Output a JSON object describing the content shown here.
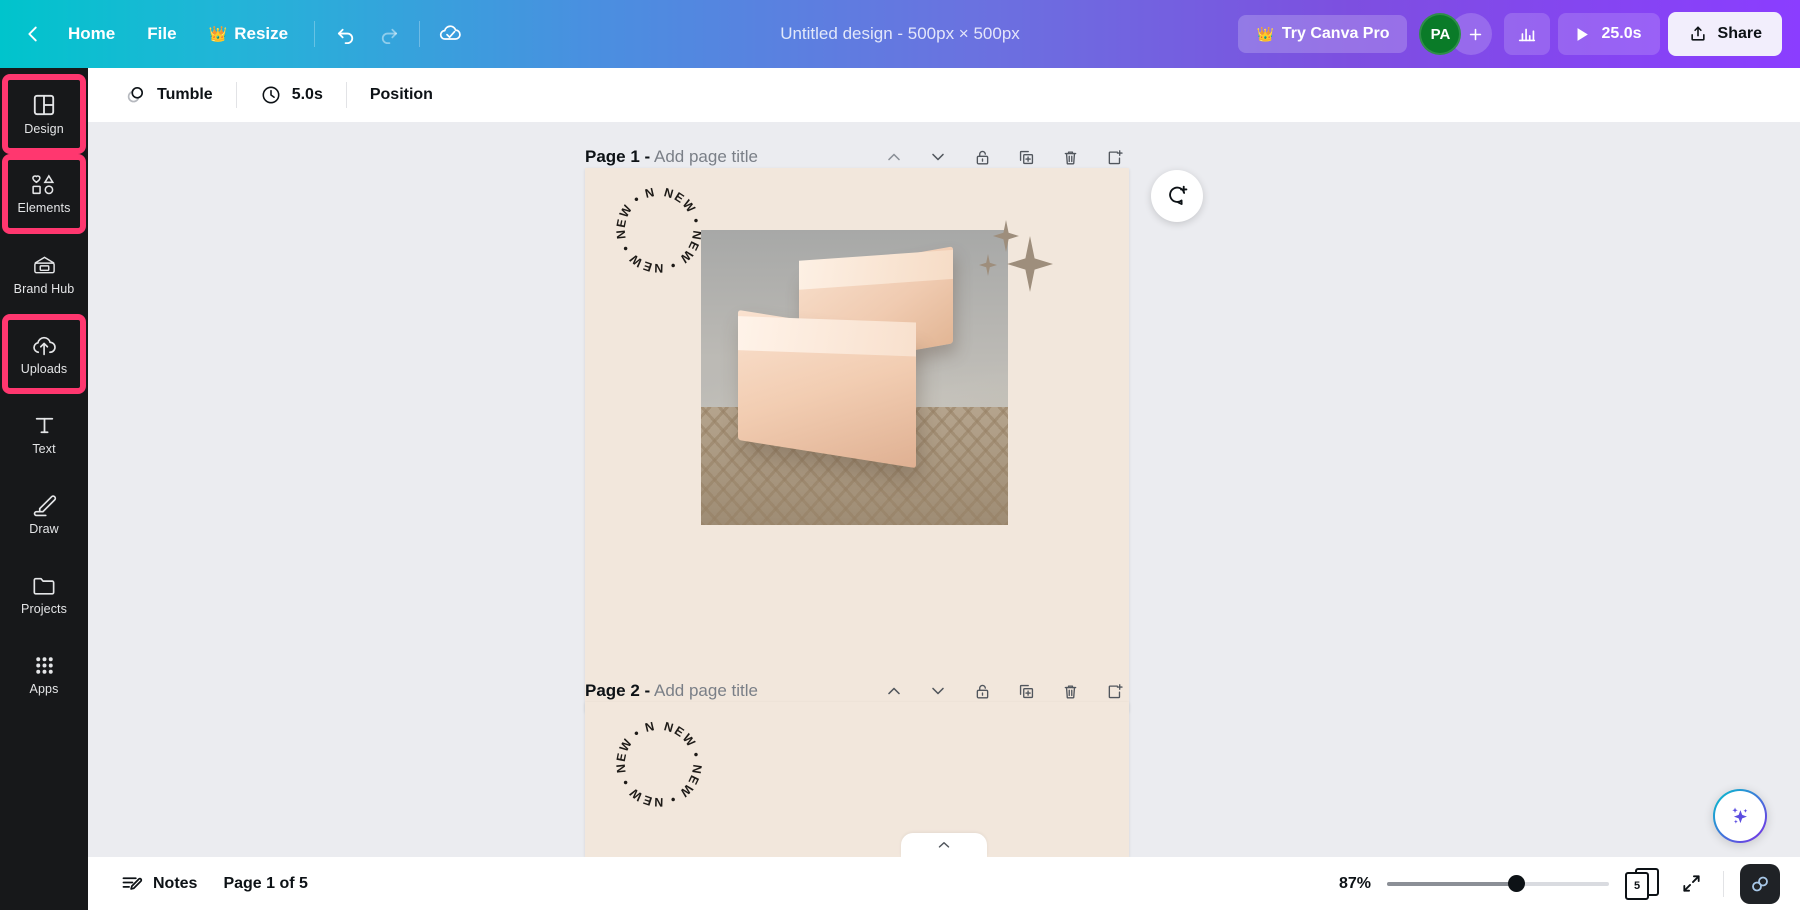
{
  "topbar": {
    "back_icon": "chevron-left-icon",
    "home_label": "Home",
    "file_label": "File",
    "resize_label": "Resize",
    "resize_icon": "crown-icon",
    "undo_icon": "undo-icon",
    "redo_icon": "redo-icon",
    "saved_icon": "cloud-check-icon",
    "design_title": "Untitled design - 500px × 500px",
    "pro_label": "Try Canva Pro",
    "pro_icon": "crown-icon",
    "avatar_initials": "PA",
    "avatar_color": "#0a7b28",
    "add_collaborator_icon": "plus-icon",
    "insights_icon": "bar-chart-icon",
    "play_icon": "play-icon",
    "duration_label": "25.0s",
    "share_label": "Share",
    "share_icon": "upload-icon",
    "gradient_start": "#00c4cc",
    "gradient_end": "#8b3dff"
  },
  "sidebar": {
    "highlight_color": "#ff376f",
    "items": [
      {
        "label": "Design",
        "icon": "layout-grid-icon",
        "highlighted": true
      },
      {
        "label": "Elements",
        "icon": "shapes-icon",
        "highlighted": true
      },
      {
        "label": "Brand Hub",
        "icon": "brand-wallet-icon",
        "highlighted": false
      },
      {
        "label": "Uploads",
        "icon": "cloud-upload-icon",
        "highlighted": true
      },
      {
        "label": "Text",
        "icon": "text-t-icon",
        "highlighted": false
      },
      {
        "label": "Draw",
        "icon": "pen-icon",
        "highlighted": false
      },
      {
        "label": "Projects",
        "icon": "folder-icon",
        "highlighted": false
      },
      {
        "label": "Apps",
        "icon": "grid-dots-icon",
        "highlighted": false
      }
    ]
  },
  "subtoolbar": {
    "animation_icon": "tumble-animation-icon",
    "animation_label": "Tumble",
    "timing_icon": "clock-icon",
    "timing_label": "5.0s",
    "position_label": "Position"
  },
  "canvas": {
    "comment_icon": "add-comment-icon",
    "ai_icon": "magic-sparkle-icon",
    "page_action_icons": [
      "chevron-up-icon",
      "chevron-down-icon",
      "unlock-icon",
      "duplicate-page-icon",
      "delete-page-icon",
      "expand-page-icon"
    ],
    "pages": [
      {
        "number_label": "Page 1 -",
        "title_placeholder": "Add page title",
        "background": "#f2e7dc",
        "badge_text": "NEW",
        "badge_repeat": 5,
        "badge_separator": "•",
        "sparkle_color": "#9e8e7c"
      },
      {
        "number_label": "Page 2 -",
        "title_placeholder": "Add page title",
        "background": "#f2e7dc",
        "badge_text": "NEW",
        "badge_repeat": 5,
        "badge_separator": "•",
        "sparkle_color": "#9e8e7c"
      }
    ]
  },
  "bottombar": {
    "notes_icon": "notes-icon",
    "notes_label": "Notes",
    "page_indicator": "Page 1 of 5",
    "zoom_label": "87%",
    "zoom_percent": 87,
    "slider_fill_percent": 58,
    "pages_count_label": "5",
    "pages_icon": "page-stack-icon",
    "fullscreen_icon": "expand-arrows-icon",
    "help_icon": "help-icon",
    "collapse_icon": "chevron-up-icon"
  }
}
